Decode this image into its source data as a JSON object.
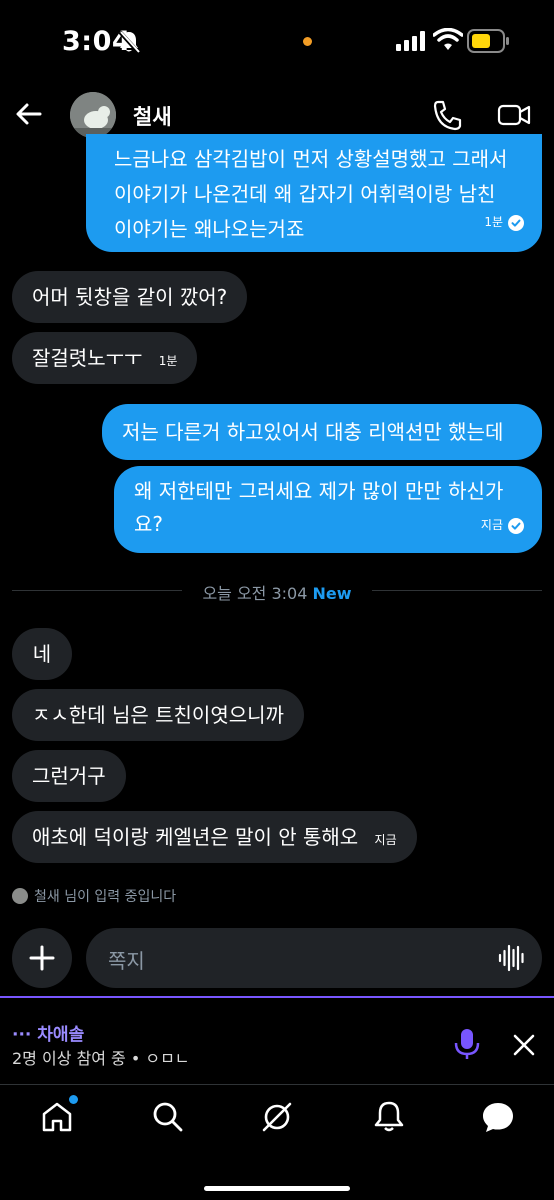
{
  "status_bar": {
    "time": "3:04"
  },
  "header": {
    "contact_name": "철새"
  },
  "messages_sent_1": {
    "lines": [
      "느금나요 삼각김밥이 먼저 상황설명했고 그래서",
      "이야기가 나온건데 왜 갑자기 어휘력이랑 남친",
      "이야기는 왜나오는거죠"
    ],
    "time": "1분"
  },
  "messages_received_1": [
    {
      "text": "어머 뒷창을 같이 깠어?"
    },
    {
      "text": "잘걸렷노ㅜㅜ",
      "time": "1분"
    }
  ],
  "messages_sent_2": {
    "first": "저는 다른거 하고있어서 대충 리액션만 했는데",
    "lines": [
      "왜 저한테만 그러세요 제가 많이 만만 하신가",
      "요?"
    ],
    "time": "지금"
  },
  "date_separator": {
    "text": "오늘 오전 3:04",
    "new_label": "New"
  },
  "messages_received_2": [
    {
      "text": "네"
    },
    {
      "text": "ㅈㅅ한데 님은 트친이엿으니까"
    },
    {
      "text": "그런거구"
    },
    {
      "text": "애초에 덕이랑 케엘년은 말이 안 통해오",
      "time": "지금"
    }
  ],
  "typing_indicator": "철새 님이 입력 중입니다",
  "composer": {
    "placeholder": "쪽지"
  },
  "space": {
    "title": "··· 차애솔",
    "subtitle": "2명 이상 참여 중 • ㅇㅁㄴ"
  },
  "bottom_nav": {
    "items": [
      "home",
      "search",
      "grok",
      "notifications",
      "messages"
    ]
  },
  "colors": {
    "accent": "#1d9bf0",
    "incoming_bubble": "#202327",
    "space_purple": "#7856ff"
  }
}
